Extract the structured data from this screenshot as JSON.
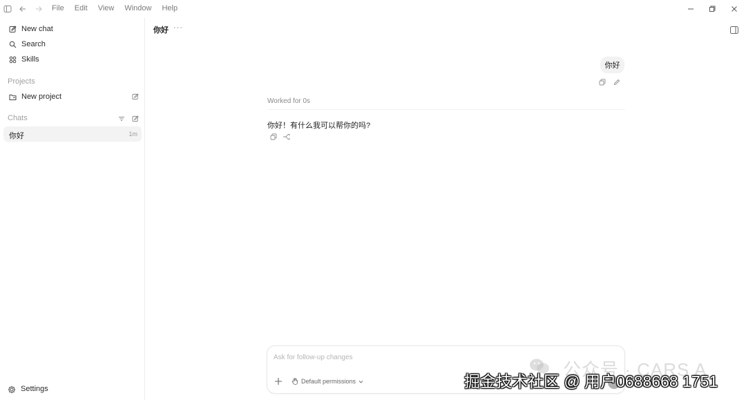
{
  "menu": [
    "File",
    "Edit",
    "View",
    "Window",
    "Help"
  ],
  "sidebar": {
    "new_chat": "New chat",
    "search": "Search",
    "skills": "Skills",
    "projects_label": "Projects",
    "new_project": "New project",
    "chats_label": "Chats",
    "chats": [
      {
        "title": "你好",
        "time": "1m"
      }
    ],
    "settings": "Settings"
  },
  "main": {
    "title": "你好",
    "more": "···",
    "user_message": "你好",
    "worked": "Worked for 0s",
    "assistant_message": "你好！有什么我可以帮你的吗?"
  },
  "composer": {
    "placeholder": "Ask for follow-up changes",
    "permissions": "Default permissions"
  },
  "watermark": {
    "faint": "公众号 · CARS A",
    "main": "掘金技术社区 @ 用户0688668 1751"
  },
  "icons": [
    "sidebar-toggle-icon",
    "back-arrow-icon",
    "forward-arrow-icon",
    "edit-icon",
    "search-icon",
    "skills-icon",
    "folder-icon",
    "filter-icon",
    "settings-gear-icon",
    "copy-icon",
    "pencil-icon",
    "branch-icon",
    "plus-icon",
    "hand-icon",
    "chevron-down-icon",
    "panel-icon",
    "minimize-icon",
    "maximize-icon",
    "close-icon"
  ]
}
